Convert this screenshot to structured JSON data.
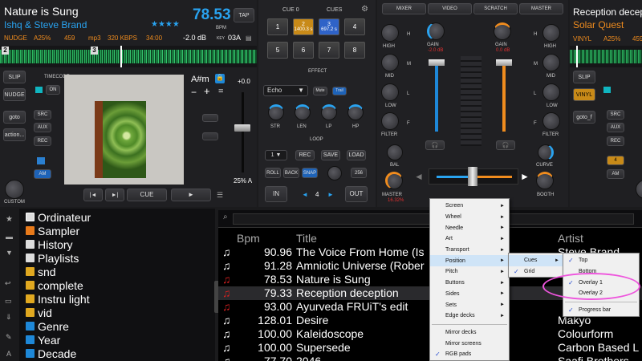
{
  "left_deck": {
    "title": "Nature is Sung",
    "artist": "Ishq & Steve Brand",
    "stars": "★★★★",
    "bpm": "78.53",
    "bpm_unit": "BPM",
    "tap": "TAP",
    "gain": "-2.0 dB",
    "key_label": "KEY",
    "key": "03A",
    "mode": "NUDGE",
    "pitch": "A25%",
    "num": "459",
    "format": "mp3",
    "bitrate": "320 KBPS",
    "time": "34:00",
    "marker1": "2",
    "marker2": "3",
    "slip": "SLIP",
    "nudge": "NUDGE",
    "goto": "goto",
    "action": "action...",
    "timecode": "TIMECODE",
    "on": "ON",
    "src": "SRC",
    "aux": "AUX",
    "rec": "REC",
    "am": "AM",
    "custom": "CUSTOM",
    "keylock": "A#m",
    "pitch_val": "+0.0",
    "pitch_pct": "25% A",
    "cue": "CUE",
    "play": "►",
    "prev": "|◄",
    "next": "►|"
  },
  "fx": {
    "cue_label": "CUE 0",
    "cues_label": "CUES",
    "pads": [
      "1",
      "2",
      "3",
      "4",
      "5",
      "6",
      "7",
      "8"
    ],
    "pad2_time": "1400.3 s",
    "pad3_time": "697.2 s",
    "effect_title": "EFFECT",
    "effect": "Echo",
    "mute": "Mute",
    "trail": "Trail",
    "knobs": [
      "STR",
      "LEN",
      "LP",
      "HP"
    ],
    "loop_title": "LOOP",
    "loop_num": "1",
    "rec": "REC",
    "save": "SAVE",
    "load": "LOAD",
    "roll": "ROLL",
    "back": "BACK",
    "snap": "SNAP",
    "loop_len": "256",
    "in": "IN",
    "out": "OUT",
    "beats": "4"
  },
  "mixer": {
    "tabs": [
      "MIXER",
      "VIDEO",
      "SCRATCH",
      "MASTER"
    ],
    "gain": "GAIN",
    "gain_l": "-2.0 dB",
    "gain_r": "0.0 dB",
    "high": "HIGH",
    "mid": "MID",
    "low": "LOW",
    "filter": "FILTER",
    "bal": "BAL",
    "master": "MASTER",
    "master_val": "16.32%",
    "h": "H",
    "m": "M",
    "l": "L",
    "f": "F"
  },
  "right_deck": {
    "title": "Reception decep",
    "artist": "Solar Quest",
    "mode": "VINYL",
    "pitch": "A25%",
    "num": "459",
    "slip": "SLIP",
    "vinyl": "VINYL",
    "goto": "goto_f",
    "curve": "CURVE",
    "booth": "BOOTH",
    "custom": "CUSTOM",
    "src": "SRC",
    "aux": "AUX",
    "rec": "REC",
    "am": "AM",
    "four": "4"
  },
  "browser": {
    "tree": [
      "Ordinateur",
      "Sampler",
      "History",
      "Playlists",
      "snd",
      "complete",
      "Instru light",
      "vid",
      "Genre",
      "Year",
      "Decade"
    ],
    "sidebar_tab": "folders",
    "columns": {
      "bpm": "Bpm",
      "title": "Title",
      "artist": "Artist"
    },
    "rows": [
      {
        "bpm": "90.96",
        "title": "The Voice From Home (Is",
        "artist": "Steve Brand"
      },
      {
        "bpm": "91.28",
        "title": "Amniotic Universe (Rober",
        "artist": ""
      },
      {
        "bpm": "78.53",
        "title": "Nature is Sung",
        "artist": ""
      },
      {
        "bpm": "79.33",
        "title": "Reception deception",
        "artist": ""
      },
      {
        "bpm": "93.00",
        "title": "Ayurveda FRUiT's edit",
        "artist": ""
      },
      {
        "bpm": "128.01",
        "title": "Desire",
        "artist": "Makyo"
      },
      {
        "bpm": "100.00",
        "title": "Kaleidoscope",
        "artist": "Colourform"
      },
      {
        "bpm": "100.00",
        "title": "Supersede",
        "artist": "Carbon Based L"
      },
      {
        "bpm": "77.70",
        "title": "2046",
        "artist": "Saafi Brothers"
      }
    ]
  },
  "menu": {
    "items": [
      "Screen",
      "Wheel",
      "Needle",
      "Art",
      "Transport",
      "Position",
      "Pitch",
      "Buttons",
      "Sides",
      "Sets",
      "Edge decks",
      "Mirror decks",
      "Mirror screens",
      "RGB pads"
    ],
    "sub1": [
      "Cues",
      "Grid"
    ],
    "sub2": [
      "Top",
      "Bottom",
      "Overlay 1",
      "Overlay 2",
      "Progress bar"
    ]
  }
}
